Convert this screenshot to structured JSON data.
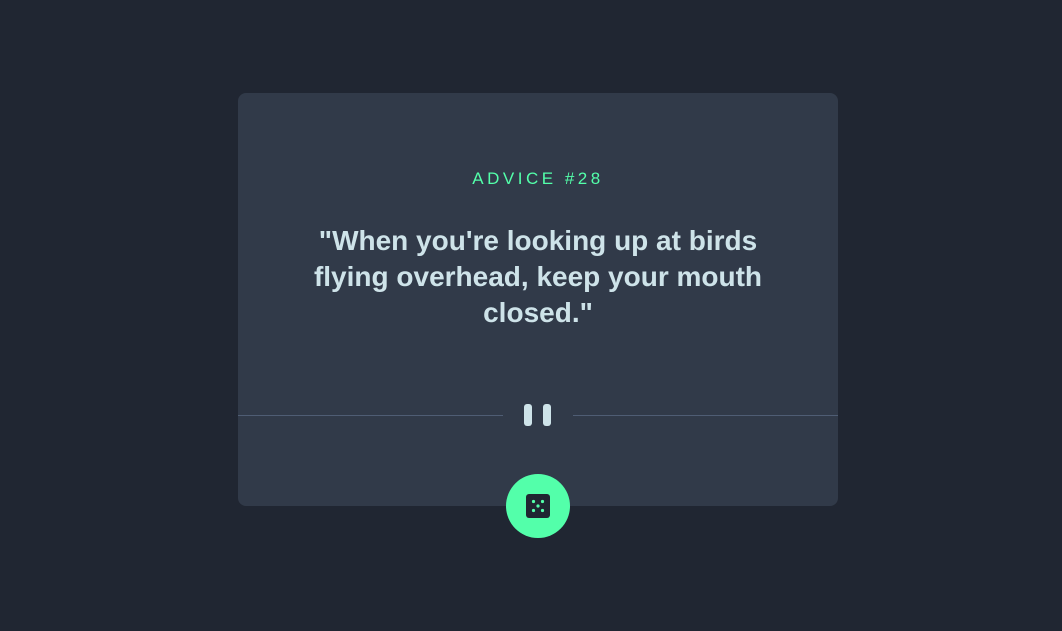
{
  "advice": {
    "label": "ADVICE #28",
    "quote": "\"When you're looking up at birds flying overhead, keep your mouth closed.\""
  },
  "divider": {
    "icon": "pause-icon"
  },
  "dice_button": {
    "icon": "dice-icon"
  },
  "colors": {
    "background": "#202632",
    "card": "#313a49",
    "accent": "#53ffaa",
    "text": "#cee3e9",
    "divider_line": "#4f5d74"
  }
}
